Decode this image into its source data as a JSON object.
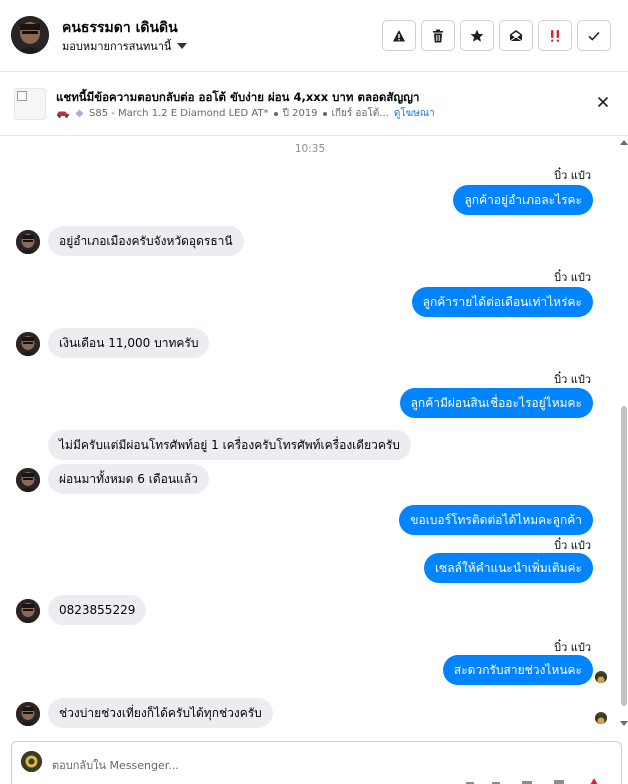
{
  "header": {
    "contact_name": "คนธรรมดา เดินดิน",
    "assign_label": "มอบหมายการสนทนานี้"
  },
  "listing": {
    "title": "แชทนี้มีข้อความตอบกลับต่อ ออโต้ ขับง่าย ผ่อน 4,xxx บาท ตลอดสัญญา",
    "model": "S85 - March 1.2 E Diamond LED AT*",
    "year": "ปี 2019",
    "gear": "เกียร์ ออโต้...",
    "view_link": "ดูโฆษณา"
  },
  "conversation": {
    "timestamp": "10:35",
    "messages": [
      {
        "dir": "out",
        "sender": "บิ๋ว แป๋ว",
        "text": "ลูกค้าอยู่อำเภอละไรคะ"
      },
      {
        "dir": "in",
        "text": "อยู่อำเภอเมืองครับจังหวัดอุดรธานี"
      },
      {
        "dir": "out",
        "sender": "บิ๋ว แป๋ว",
        "text": "ลูกค้ารายได้ต่อเดือนเท่าไหร่คะ"
      },
      {
        "dir": "in",
        "text": "เงินเดือน 11,000 บาทครับ"
      },
      {
        "dir": "out",
        "sender": "บิ๋ว แป๋ว",
        "text": "ลูกค้ามีผ่อนสินเชื่ออะไรอยู่ไหมคะ"
      },
      {
        "dir": "in",
        "text": "ไม่มีครับแต่มีผ่อนโทรศัพท์อยู่ 1 เครื่องครับโทรศัพท์เครื่องเดียวครับ"
      },
      {
        "dir": "in",
        "text": "ผ่อนมาทั้งหมด 6 เดือนแล้ว"
      },
      {
        "dir": "out",
        "text": "ขอเบอร์โทรติดต่อได้ไหมคะลูกค้า"
      },
      {
        "dir": "out",
        "sender": "บิ๋ว แป๋ว",
        "text": "เซลล์ให้คำแนะนำเพิ่มเติมค่ะ"
      },
      {
        "dir": "in",
        "text": "0823855229"
      },
      {
        "dir": "out",
        "sender": "บิ๋ว แป๋ว",
        "text": "สะดวกรับสายช่วงไหนคะ"
      },
      {
        "dir": "in",
        "text": "ช่วงบ่ายช่วงเที่ยงก็ได้ครับได้ทุกช่วงครับ"
      }
    ]
  },
  "composer": {
    "placeholder": "ตอบกลับใน Messenger..."
  },
  "icons": {
    "report": "warning-icon",
    "delete": "trash-icon",
    "star": "star-icon",
    "read": "envelope-open-icon",
    "priority": "priority-icon",
    "done": "check-icon",
    "close": "close-icon"
  },
  "colors": {
    "outgoing_bubble": "#0084ff",
    "incoming_bubble": "#ebedf0",
    "priority": "#e41e3f",
    "link": "#1b74e4"
  }
}
